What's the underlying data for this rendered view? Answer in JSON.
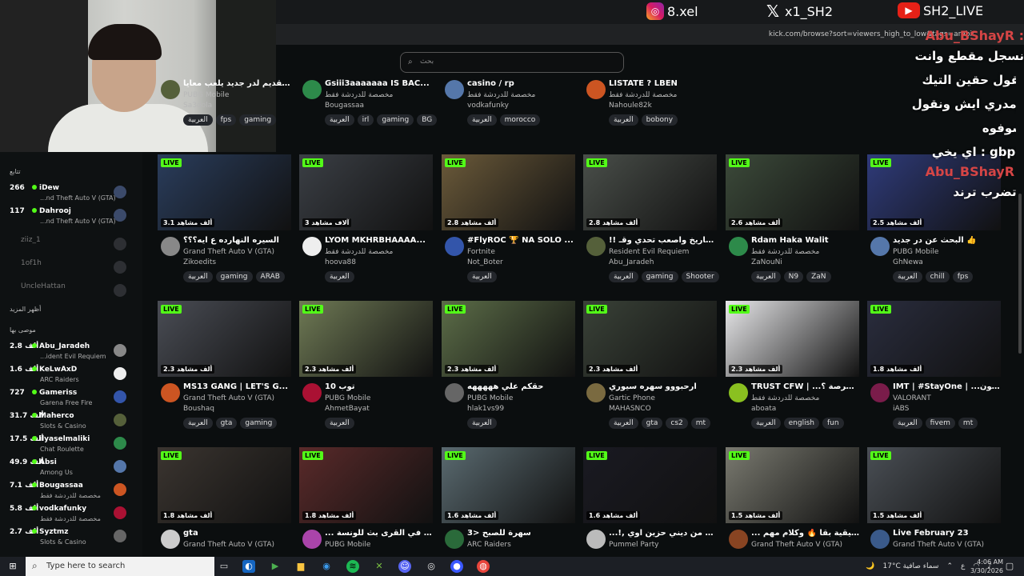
{
  "browser": {
    "url": "kick.com/browse?sort=viewers_high_to_low&tags=arabic",
    "search_placeholder": "بحث"
  },
  "overlay": {
    "instagram": "8.xel",
    "x": "x1_SH2",
    "youtube": "SH2_LIVE"
  },
  "chat": [
    {
      "user": "Abu_BShayR :",
      "msg": "نسجل مقطع وانت تقول حقين التيك ومدري ايش ونقول شوفوه"
    },
    {
      "user": "",
      "msg": "اي يخي : gbpd"
    },
    {
      "user": "Abu_BShayR :",
      "msg": "وتضرب ترند"
    }
  ],
  "sidebar": {
    "following_heading": "تتابع",
    "following": [
      {
        "count": "266",
        "name": "iDew",
        "game": "...nd Theft Auto V (GTA)"
      },
      {
        "count": "117",
        "name": "Dahrooj",
        "game": "...nd Theft Auto V (GTA)"
      }
    ],
    "offline": [
      "ziiz_1",
      "1of1h",
      "UncleHattan"
    ],
    "show_more": "أظهر المزيد",
    "recommended_heading": "موصى بها",
    "recommended": [
      {
        "count": "2.8 ألف",
        "name": "Abu_Jaradeh",
        "game": "...ident Evil Requiem"
      },
      {
        "count": "1.6 ألف",
        "name": "KeLwAxD",
        "game": "ARC Raiders"
      },
      {
        "count": "727",
        "name": "Gameriss",
        "game": "Garena Free Fire"
      },
      {
        "count": "31.7 ألف",
        "name": "Maherco",
        "game": "Slots & Casino"
      },
      {
        "count": "17.5 ألف",
        "name": "ilyaselmaliki",
        "game": "Chat Roulette"
      },
      {
        "count": "49.9 ألف",
        "name": "Absi",
        "game": "Among Us"
      },
      {
        "count": "7.1 ألف",
        "name": "Bougassaa",
        "game": "مخصصة للدردشة فقط"
      },
      {
        "count": "5.8 ألف",
        "name": "vodkafunky",
        "game": "مخصصة للدردشة فقط"
      },
      {
        "count": "2.7 ألف",
        "name": "Syztmz",
        "game": "Slots & Casino"
      }
    ]
  },
  "live_label": "LIVE",
  "top_row": [
    {
      "title": "فتح التقديم لدر جديد يلعب معايا !!",
      "game": "PUBG Mobile",
      "user": "Sa3dola",
      "tags": [
        "العربية",
        "fps",
        "gaming"
      ]
    },
    {
      "title": "Gsiii3aaaaaaa IS BAC...",
      "game": "مخصصة للدردشة فقط",
      "user": "Bougassaa",
      "tags": [
        "العربية",
        "irl",
        "gaming",
        "BG"
      ]
    },
    {
      "title": "casino / rp",
      "game": "مخصصة للدردشة فقط",
      "user": "vodkafunky",
      "tags": [
        "العربية",
        "morocco"
      ]
    },
    {
      "title": "LISTATE ? LBEN",
      "game": "مخصصة للدردشة فقط",
      "user": "Nahoule82k",
      "tags": [
        "العربية",
        "bobony"
      ]
    }
  ],
  "streams": [
    {
      "viewers": "3.1 ألف مشاهد",
      "title": "السيره النهارده ع ايه؟؟؟",
      "game": "Grand Theft Auto V (GTA)",
      "user": "Zikoedits",
      "tags": [
        "العربية",
        "gaming",
        "ARAB"
      ]
    },
    {
      "viewers": "3 آلاف مشاهد",
      "title": "LYOM MKHRBHAAAA...",
      "game": "مخصصة للدردشة فقط",
      "user": "hoova88",
      "tags": [
        "العربية"
      ]
    },
    {
      "viewers": "2.8 ألف مشاهد",
      "title": "#FlyROC 🏆 NA SOLO ...",
      "game": "Fortnite",
      "user": "Not_Boter",
      "tags": [
        "العربية"
      ]
    },
    {
      "viewers": "2.8 ألف مشاهد",
      "title": "!! اليوم التاريخ واصعب تحدي وقـ",
      "game": "Resident Evil Requiem",
      "user": "Abu_Jaradeh",
      "tags": [
        "العربية",
        "gaming",
        "Shooter"
      ]
    },
    {
      "viewers": "2.6 ألف مشاهد",
      "title": "Rdam Haka Walit",
      "game": "مخصصة للدردشة فقط",
      "user": "ZaNouNi",
      "tags": [
        "العربية",
        "N9",
        "ZaN"
      ]
    },
    {
      "viewers": "2.5 ألف مشاهد",
      "title": "البحث عن در جديد 👍",
      "game": "PUBG Mobile",
      "user": "GhNewa",
      "tags": [
        "العربية",
        "chill",
        "fps"
      ]
    },
    {
      "viewers": "2.3 ألف مشاهد",
      "title": "MS13 GANG | LET'S G...",
      "game": "Grand Theft Auto V (GTA)",
      "user": "Boushaq",
      "tags": [
        "العربية",
        "gta",
        "gaming"
      ]
    },
    {
      "viewers": "2.3 ألف مشاهد",
      "title": "توب 10",
      "game": "PUBG Mobile",
      "user": "AhmetBayat",
      "tags": [
        "العربية"
      ]
    },
    {
      "viewers": "2.3 ألف مشاهد",
      "title": "حقكم علي هههههه",
      "game": "PUBG Mobile",
      "user": "hlak1vs99",
      "tags": [
        "العربية"
      ]
    },
    {
      "viewers": "2.3 ألف مشاهد",
      "title": "ارحبووو سهره سيوري",
      "game": "Gartic Phone",
      "user": "MAHASNCO",
      "tags": [
        "العربية",
        "gta",
        "cs2",
        "mt"
      ]
    },
    {
      "viewers": "2.3 ألف مشاهد",
      "title": "TRUST CFW | ...ن فرصة ؟",
      "game": "مخصصة للدردشة فقط",
      "user": "aboata",
      "tags": [
        "العربية",
        "english",
        "fun"
      ]
    },
    {
      "viewers": "1.8 ألف مشاهد",
      "title": "IMT | #StayOne | ...ليفالون",
      "game": "VALORANT",
      "user": "iABS",
      "tags": [
        "العربية",
        "fivem",
        "mt"
      ]
    },
    {
      "viewers": "1.8 ألف مشاهد",
      "title": "gta",
      "game": "Grand Theft Auto V (GTA)",
      "user": "",
      "tags": []
    },
    {
      "viewers": "1.8 ألف مشاهد",
      "title": "... و نضحك في القرى بث للونسة",
      "game": "PUBG Mobile",
      "user": "",
      "tags": []
    },
    {
      "viewers": "1.6 ألف مشاهد",
      "title": "سهرة للصبح <3",
      "game": "ARC Raiders",
      "user": "",
      "tags": []
    },
    {
      "viewers": "1.6 ألف مشاهد",
      "title": "...!, والحلال من ديني حزين اوي",
      "game": "Pummel Party",
      "user": "",
      "tags": []
    },
    {
      "viewers": "1.5 ألف مشاهد",
      "title": "... العودة الحقيقية بقا 🔥 وكلام مهم",
      "game": "Grand Theft Auto V (GTA)",
      "user": "",
      "tags": []
    },
    {
      "viewers": "1.5 ألف مشاهد",
      "title": "Live February 23",
      "game": "Grand Theft Auto V (GTA)",
      "user": "",
      "tags": []
    }
  ],
  "thumb_colors": [
    "#2a3d5c",
    "#3b3f45",
    "#6b5a3a",
    "#4a4f4a",
    "#3c4a3a",
    "#2f3b7a",
    "#4a4d55",
    "#6f7a55",
    "#5c6d48",
    "#3a4238",
    "#e8e8ea",
    "#2a2d3e",
    "#3b3530",
    "#5a2a2a",
    "#5a6a70",
    "#1a1a22",
    "#7a7a70",
    "#4a4f55"
  ],
  "avatar_colors": [
    "#888",
    "#eee",
    "#3355aa",
    "#55603a",
    "#2d8a4a",
    "#5577aa",
    "#cc5522",
    "#aa1133",
    "#666",
    "#7a6a40",
    "#8ac020",
    "#7a1c4a",
    "#ccc",
    "#aa44aa",
    "#2a6a3a",
    "#bbb",
    "#884422",
    "#3a5a8a"
  ],
  "taskbar": {
    "search": "Type here to search",
    "weather": "17°C  سماء صافية",
    "time": "4:06 AM",
    "date": "3/30/2026",
    "lang": "ع"
  }
}
